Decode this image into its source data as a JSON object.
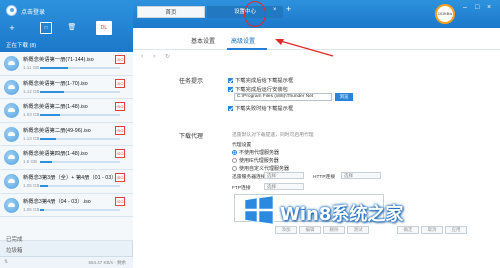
{
  "app": {
    "login_text": "点击登录",
    "section_label": "正在下载 (8)"
  },
  "tabs": [
    {
      "label": "首页"
    },
    {
      "label": "设置中心"
    }
  ],
  "speed_indicator": "101KB/s",
  "toolbar_left": {
    "add_icon": "+",
    "box_label": "□",
    "delete_icon": "🗑",
    "download_label": "DL"
  },
  "downloads": [
    {
      "name": "新概念英语第一册(71-144).iso",
      "size": "1.11 GB",
      "progress": 0.35
    },
    {
      "name": "新概念英语第一册(1-70).iso",
      "size": "1.12 GB",
      "progress": 0.3
    },
    {
      "name": "新概念英语第二册(1-48).iso",
      "size": "1.03 GB",
      "progress": 0.25
    },
    {
      "name": "新概念英语第二册(49-96).iso",
      "size": "1.13 GB",
      "progress": 0.2
    },
    {
      "name": "新概念英语第四册(1-48).iso",
      "size": "1.6 GB",
      "progress": 0.15
    },
    {
      "name": "新概念3第3册（全）+ 第4册（01 - 03）",
      "size": "1.05 GB",
      "progress": 0.1
    },
    {
      "name": "新概念3第4册（04 - 03）.iso",
      "size": "1.06 GB",
      "progress": 0.05
    }
  ],
  "footer": {
    "completed": "已完成",
    "trash": "垃圾箱",
    "speed": "554.47 KB/s · 剩余"
  },
  "subtabs": {
    "basic": "基本设置",
    "advanced": "高级设置"
  },
  "task_tips": {
    "title": "任务提示",
    "items": [
      "下载完成后给下载提示框",
      "下载完成后运行安装包"
    ],
    "path_value": "C:\\Program Files (x86)\\Thunder Net",
    "browse_label": "浏览",
    "last_item": "下载失败时给下载提示框"
  },
  "proxy": {
    "title": "下载代理",
    "hint": "迅雷默认对下载提速，同时可启用代理",
    "settings_label": "代理设置",
    "options": [
      "不使用代理服务器",
      "使用IE代理服务器",
      "使用自定义代理服务器"
    ],
    "server_label": "迅雷服务器连接",
    "http_label": "HTTP连接",
    "ftp_label": "FTP连接",
    "field_placeholder": "选择",
    "buttons": [
      "添加",
      "编辑",
      "删除",
      "测试",
      "确定",
      "取消",
      "应用"
    ]
  },
  "watermark": {
    "text": "Win8系统之家"
  },
  "colors": {
    "accent": "#2380d6",
    "header": "#1c78c9",
    "annotation": "#e02a2a"
  }
}
